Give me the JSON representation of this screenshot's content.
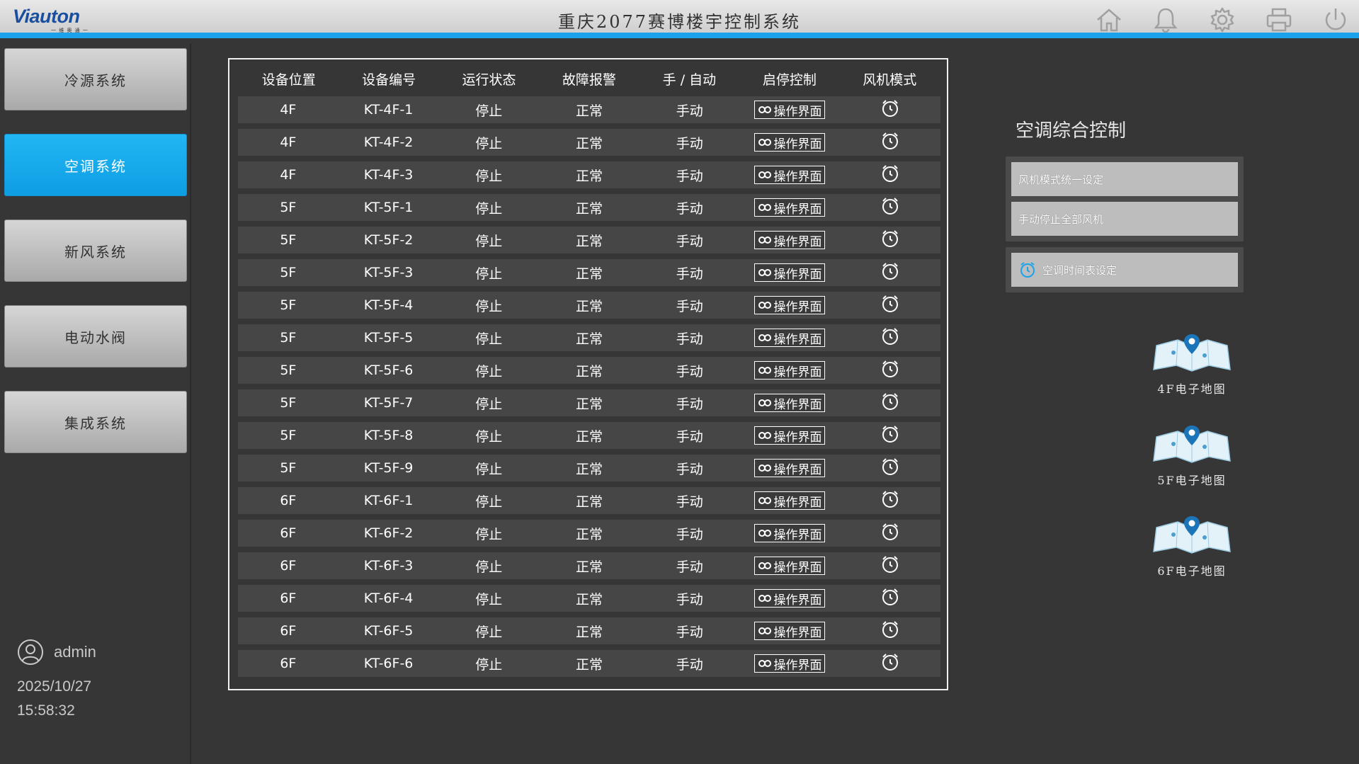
{
  "header": {
    "logo": "Viauton",
    "logo_sub": "一 维 奥 通 一",
    "title": "重庆2077赛博楼宇控制系统",
    "icons": [
      "home-icon",
      "bell-icon",
      "gear-icon",
      "printer-icon",
      "power-icon"
    ]
  },
  "sidebar": {
    "items": [
      {
        "label": "冷源系统",
        "active": false
      },
      {
        "label": "空调系统",
        "active": true
      },
      {
        "label": "新风系统",
        "active": false
      },
      {
        "label": "电动水阀",
        "active": false
      },
      {
        "label": "集成系统",
        "active": false
      }
    ],
    "user": "admin",
    "date": "2025/10/27",
    "time": "15:58:32"
  },
  "table": {
    "columns": [
      "设备位置",
      "设备编号",
      "运行状态",
      "故障报警",
      "手 / 自动",
      "启停控制",
      "风机模式"
    ],
    "op_label": "操作界面",
    "rows": [
      {
        "loc": "4F",
        "id": "KT-4F-1",
        "run": "停止",
        "fault": "正常",
        "mode": "手动"
      },
      {
        "loc": "4F",
        "id": "KT-4F-2",
        "run": "停止",
        "fault": "正常",
        "mode": "手动"
      },
      {
        "loc": "4F",
        "id": "KT-4F-3",
        "run": "停止",
        "fault": "正常",
        "mode": "手动"
      },
      {
        "loc": "5F",
        "id": "KT-5F-1",
        "run": "停止",
        "fault": "正常",
        "mode": "手动"
      },
      {
        "loc": "5F",
        "id": "KT-5F-2",
        "run": "停止",
        "fault": "正常",
        "mode": "手动"
      },
      {
        "loc": "5F",
        "id": "KT-5F-3",
        "run": "停止",
        "fault": "正常",
        "mode": "手动"
      },
      {
        "loc": "5F",
        "id": "KT-5F-4",
        "run": "停止",
        "fault": "正常",
        "mode": "手动"
      },
      {
        "loc": "5F",
        "id": "KT-5F-5",
        "run": "停止",
        "fault": "正常",
        "mode": "手动"
      },
      {
        "loc": "5F",
        "id": "KT-5F-6",
        "run": "停止",
        "fault": "正常",
        "mode": "手动"
      },
      {
        "loc": "5F",
        "id": "KT-5F-7",
        "run": "停止",
        "fault": "正常",
        "mode": "手动"
      },
      {
        "loc": "5F",
        "id": "KT-5F-8",
        "run": "停止",
        "fault": "正常",
        "mode": "手动"
      },
      {
        "loc": "5F",
        "id": "KT-5F-9",
        "run": "停止",
        "fault": "正常",
        "mode": "手动"
      },
      {
        "loc": "6F",
        "id": "KT-6F-1",
        "run": "停止",
        "fault": "正常",
        "mode": "手动"
      },
      {
        "loc": "6F",
        "id": "KT-6F-2",
        "run": "停止",
        "fault": "正常",
        "mode": "手动"
      },
      {
        "loc": "6F",
        "id": "KT-6F-3",
        "run": "停止",
        "fault": "正常",
        "mode": "手动"
      },
      {
        "loc": "6F",
        "id": "KT-6F-4",
        "run": "停止",
        "fault": "正常",
        "mode": "手动"
      },
      {
        "loc": "6F",
        "id": "KT-6F-5",
        "run": "停止",
        "fault": "正常",
        "mode": "手动"
      },
      {
        "loc": "6F",
        "id": "KT-6F-6",
        "run": "停止",
        "fault": "正常",
        "mode": "手动"
      }
    ]
  },
  "control_panel": {
    "title": "空调综合控制",
    "group1": [
      "风机模式统一设定",
      "手动停止全部风机"
    ],
    "schedule_label": "空调时间表设定"
  },
  "maps": [
    {
      "label": "4F电子地图"
    },
    {
      "label": "5F电子地图"
    },
    {
      "label": "6F电子地图"
    }
  ],
  "colors": {
    "accent": "#1aa3ec",
    "background": "#363636",
    "row": "#464646",
    "active_nav": "#15a8ec"
  }
}
